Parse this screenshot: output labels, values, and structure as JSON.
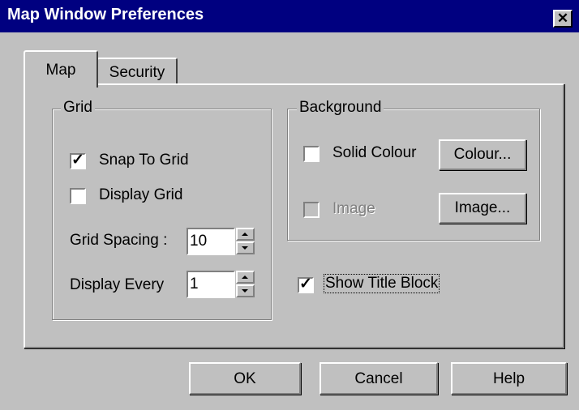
{
  "window": {
    "title": "Map Window Preferences",
    "close_glyph": "✕"
  },
  "tabs": [
    {
      "label": "Map",
      "selected": true
    },
    {
      "label": "Security",
      "selected": false
    }
  ],
  "grid": {
    "legend": "Grid",
    "snap_to_grid": {
      "label": "Snap To Grid",
      "checked": true
    },
    "display_grid": {
      "label": "Display Grid",
      "checked": false
    },
    "grid_spacing": {
      "label": "Grid Spacing :",
      "value": "10"
    },
    "display_every": {
      "label": "Display Every",
      "value": "1"
    }
  },
  "background": {
    "legend": "Background",
    "solid_colour": {
      "label": "Solid Colour",
      "checked": false
    },
    "colour_button": "Colour...",
    "image": {
      "label": "Image",
      "checked": false,
      "enabled": false
    },
    "image_button": "Image..."
  },
  "show_title_block": {
    "label": "Show Title Block",
    "checked": true
  },
  "footer": {
    "ok": "OK",
    "cancel": "Cancel",
    "help": "Help"
  },
  "glyphs": {
    "check": "✓"
  },
  "colors": {
    "titlebar": "#000080",
    "face": "#c0c0c0",
    "disabled_text": "#808080"
  }
}
